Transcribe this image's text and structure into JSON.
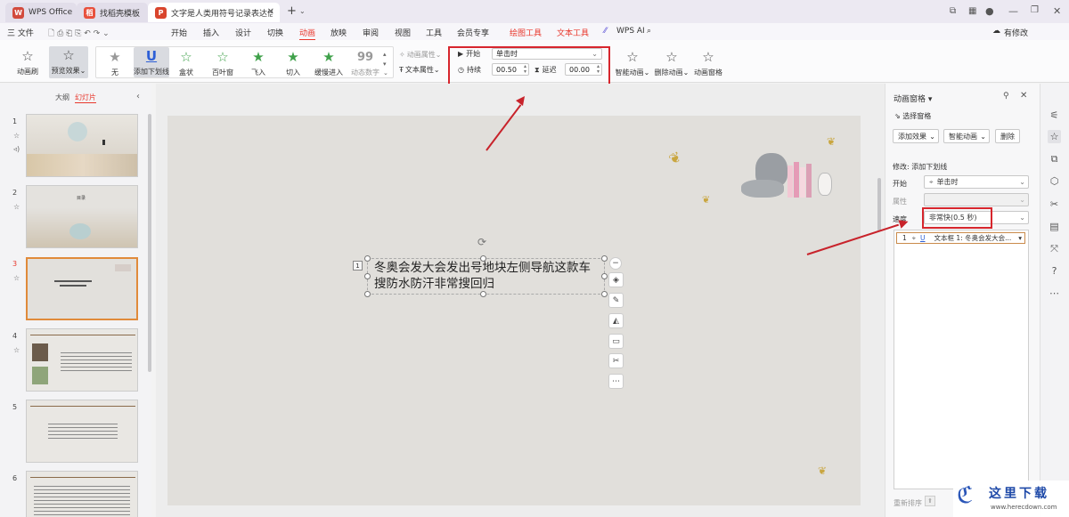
{
  "titlebar": {
    "tabs": [
      {
        "label": "WPS Office"
      },
      {
        "label": "找稻壳模板"
      },
      {
        "label": "文字是人类用符号记录表达信息以"
      }
    ],
    "add_tab": "+"
  },
  "menubar": {
    "file": "三 文件",
    "items": [
      "开始",
      "插入",
      "设计",
      "切换",
      "动画",
      "放映",
      "审阅",
      "视图",
      "工具",
      "会员专享",
      "绘图工具",
      "文本工具"
    ],
    "wps_ai": "WPS AI",
    "modify": "有修改",
    "share": "分享"
  },
  "ribbon": {
    "brush": "动画刷",
    "preview": "预览效果",
    "effects": [
      "无",
      "添加下划线",
      "盒状",
      "百叶窗",
      "飞入",
      "切入",
      "缓慢进入",
      "动态数字"
    ],
    "anim_attr": "动画属性",
    "text_attr": "文本属性",
    "start_label": "开始",
    "start_value": "单击时",
    "duration_label": "持续",
    "duration_value": "00.50",
    "delay_label": "延迟",
    "delay_value": "00.00",
    "smart": "智能动画",
    "delete": "删除动画",
    "pane": "动画窗格"
  },
  "leftpanel": {
    "tab_outline": "大纲",
    "tab_slides": "幻灯片",
    "slides": [
      "1",
      "2",
      "3",
      "4",
      "5",
      "6"
    ],
    "thumb2_title": "目录"
  },
  "slide": {
    "badge": "1",
    "text": "冬奥会发大会发出号地块左侧导航这款车搜防水防汗非常搜回归"
  },
  "rightpane": {
    "title": "动画窗格",
    "select_pane": "选择窗格",
    "add_effect": "添加效果",
    "smart": "智能动画",
    "delete": "删除",
    "modify_label": "修改: 添加下划线",
    "start_label": "开始",
    "start_value": "单击时",
    "prop_label": "属性",
    "speed_label": "速度",
    "speed_value": "非常快(0.5 秒)",
    "list_item": "文本框 1: 冬奥会发大会...",
    "list_num": "1",
    "reorder": "重新排序"
  },
  "watermark": {
    "text": "这里下载",
    "url": "www.herecdown.com"
  },
  "colors": {
    "accent": "#e8372c",
    "annotation": "#d7262d",
    "wps_tab": "#d24b3d",
    "share_btn": "#f08a2a"
  }
}
